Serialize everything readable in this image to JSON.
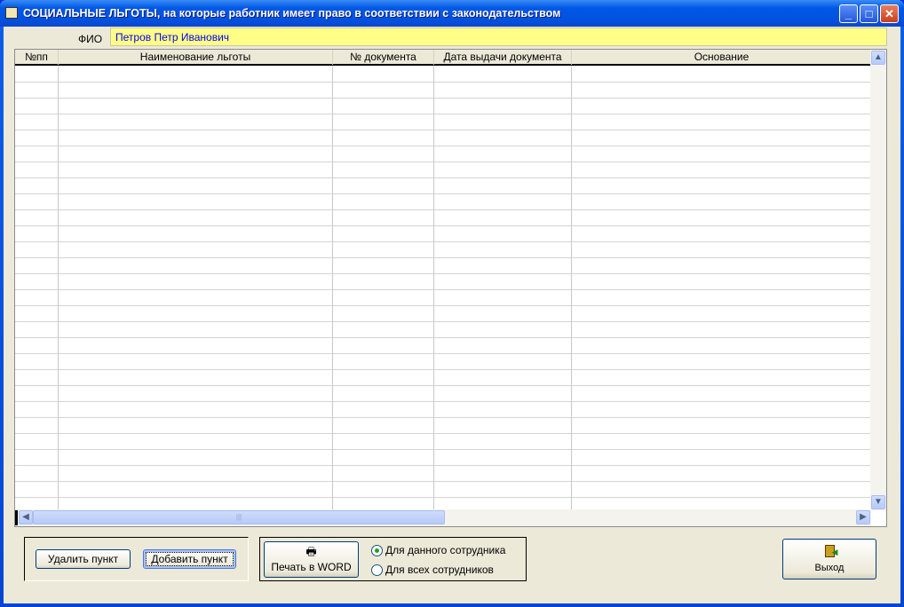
{
  "window": {
    "title": "СОЦИАЛЬНЫЕ ЛЬГОТЫ, на которые работник имеет право в соответствии с законодательством"
  },
  "fio": {
    "label": "ФИО",
    "value": "Петров Петр Иванович"
  },
  "table": {
    "columns": [
      "№пп",
      "Наименование льготы",
      "№ документа",
      "Дата выдачи документа",
      "Основание"
    ],
    "rows": []
  },
  "buttons": {
    "delete": "Удалить пункт",
    "add": "Добавить пункт",
    "print": "Печать в WORD",
    "exit": "Выход"
  },
  "print_options": [
    {
      "label": "Для данного сотрудника",
      "selected": true
    },
    {
      "label": "Для всех сотрудников",
      "selected": false
    }
  ]
}
